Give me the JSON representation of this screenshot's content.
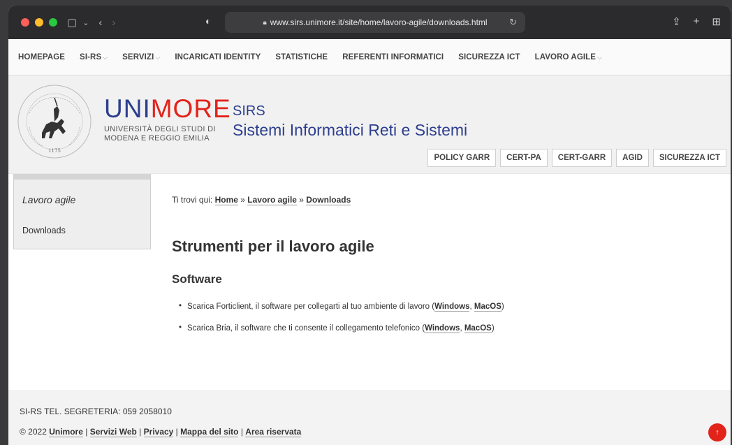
{
  "browser": {
    "url": "www.sirs.unimore.it/site/home/lavoro-agile/downloads.html",
    "traffic_colors": [
      "#ff5f57",
      "#febc2e",
      "#28c840"
    ]
  },
  "nav": {
    "items": [
      {
        "label": "HOMEPAGE",
        "caret": ""
      },
      {
        "label": "SI-RS",
        "caret": "⌵"
      },
      {
        "label": "SERVIZI",
        "caret": "⌵"
      },
      {
        "label": "INCARICATI IDENTITY",
        "caret": ""
      },
      {
        "label": "STATISTICHE",
        "caret": ""
      },
      {
        "label": "REFERENTI INFORMATICI",
        "caret": ""
      },
      {
        "label": "SICUREZZA ICT",
        "caret": ""
      },
      {
        "label": "LAVORO AGILE",
        "caret": "⌵"
      }
    ]
  },
  "header": {
    "brand_uni": "UNI",
    "brand_more": "MORE",
    "brand_sub_1": "UNIVERSITÀ DEGLI STUDI DI",
    "brand_sub_2": "MODENA E REGGIO EMILIA",
    "sirs": "SIRS",
    "sirs_full": "Sistemi Informatici Reti e Sistemi",
    "seal_year": "1175",
    "buttons": [
      "POLICY GARR",
      "CERT-PA",
      "CERT-GARR",
      "AGID",
      "SICUREZZA ICT"
    ]
  },
  "sidebar": {
    "title": "Lavoro agile",
    "item": "Downloads"
  },
  "breadcrumb": {
    "prefix": "Ti trovi qui: ",
    "home": "Home",
    "sep": " » ",
    "section": "Lavoro agile",
    "current": "Downloads"
  },
  "content": {
    "title": "Strumenti per il lavoro agile",
    "subtitle": "Software",
    "items": [
      {
        "text": "Scarica Forticlient, il software per collegarti al tuo ambiente di lavoro (",
        "win": "Windows",
        "mac": "MacOS"
      },
      {
        "text": "Scarica Bria, il software che ti consente il collegamento telefonico (",
        "win": "Windows",
        "mac": "MacOS"
      }
    ]
  },
  "footer": {
    "tel": "SI-RS TEL. SEGRETERIA: 059 2058010",
    "copyright": "© 2022 ",
    "links": [
      "Unimore",
      "Servizi Web",
      "Privacy",
      "Mappa del sito",
      "Area riservata"
    ],
    "to_top": "↑"
  }
}
